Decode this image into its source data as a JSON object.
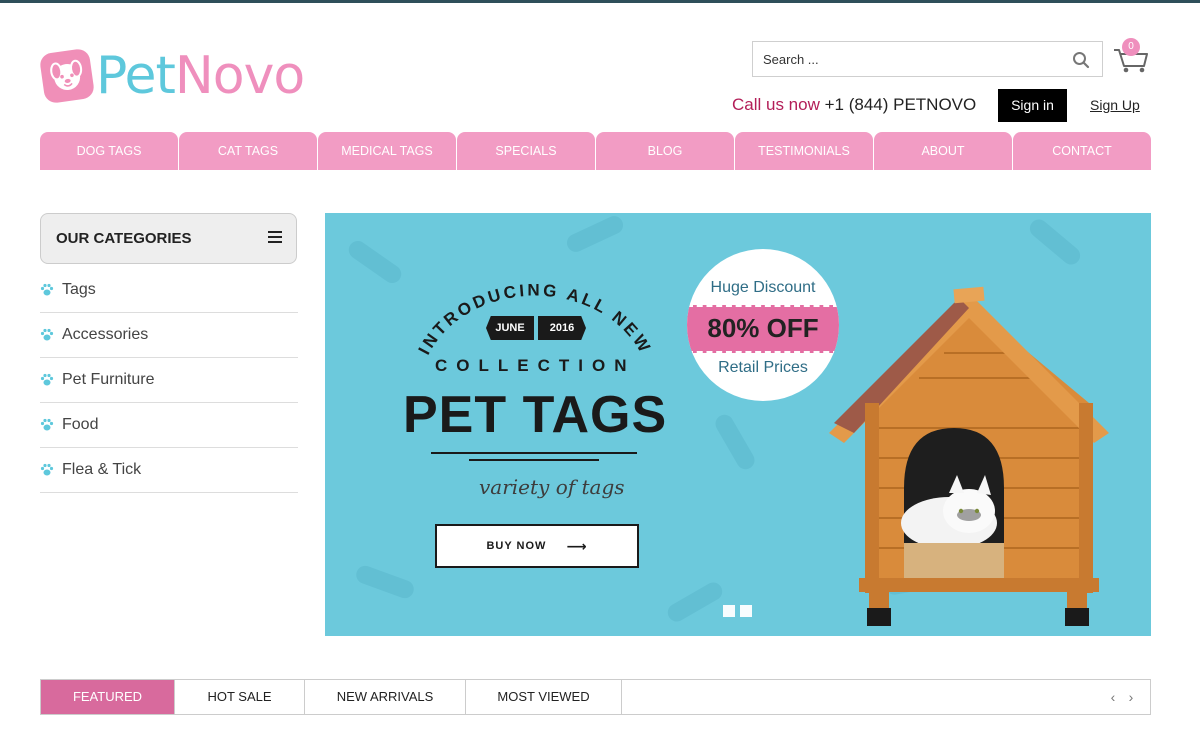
{
  "brand": {
    "part1": "Pet",
    "part2": "Novo",
    "pink": "#ef8fbd",
    "teal": "#5ec8dc"
  },
  "header": {
    "search_placeholder": "Search ...",
    "cart_count": "0",
    "call_label": "Call us now",
    "phone": "+1 (844) PETNOVO",
    "signin_label": "Sign in",
    "signup_label": "Sign Up"
  },
  "nav": {
    "items": [
      {
        "label": "DOG TAGS"
      },
      {
        "label": "CAT TAGS"
      },
      {
        "label": "MEDICAL TAGS"
      },
      {
        "label": "SPECIALS"
      },
      {
        "label": "BLOG"
      },
      {
        "label": "TESTIMONIALS"
      },
      {
        "label": "ABOUT"
      },
      {
        "label": "CONTACT"
      }
    ],
    "color": "#f29cc4"
  },
  "sidebar": {
    "title": "OUR CATEGORIES",
    "items": [
      {
        "label": "Tags",
        "icon": "paw-icon"
      },
      {
        "label": "Accessories",
        "icon": "paw-icon"
      },
      {
        "label": "Pet Furniture",
        "icon": "paw-icon"
      },
      {
        "label": "Food",
        "icon": "paw-icon"
      },
      {
        "label": "Flea & Tick",
        "icon": "paw-icon"
      }
    ]
  },
  "banner": {
    "intro": "INTRODUCING ALL NEW",
    "month": "JUNE",
    "year": "2016",
    "collection": "COLLECTION",
    "headline": "PET TAGS",
    "tagline": "variety of tags",
    "cta": "BUY NOW",
    "discount_top": "Huge Discount",
    "discount_main": "80% OFF",
    "discount_bottom": "Retail Prices",
    "background": "#6cc9dc",
    "slides_count": 2
  },
  "tabs": {
    "items": [
      {
        "label": "FEATURED",
        "active": true
      },
      {
        "label": "HOT SALE",
        "active": false
      },
      {
        "label": "NEW ARRIVALS",
        "active": false
      },
      {
        "label": "MOST VIEWED",
        "active": false
      }
    ],
    "prev": "‹",
    "next": "›"
  }
}
